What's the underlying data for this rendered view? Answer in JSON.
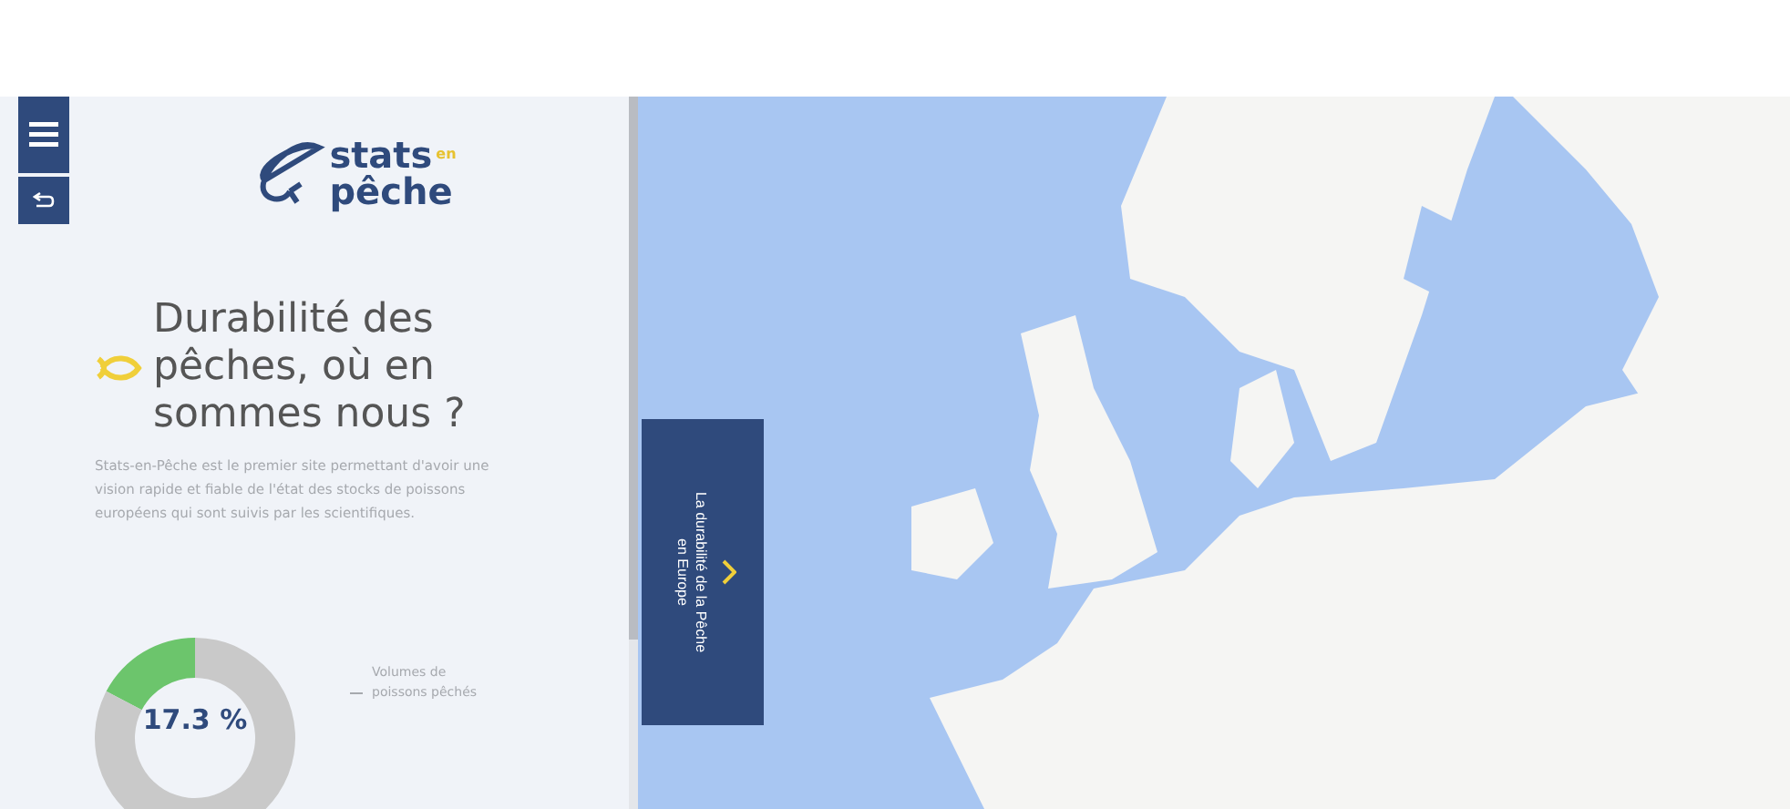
{
  "logo": {
    "line_1": "stats",
    "line_2": "en",
    "line_3": "pêche"
  },
  "title": "Durabilité des pêches, où en sommes nous ?",
  "intro": "Stats-en-Pêche est le premier site permettant d'avoir une vision rapide et fiable de l'état des stocks de poissons européens qui sont suivis par les scientifiques.",
  "summary": {
    "center_label": "17.3 %",
    "legend": "Volumes de poissons pêchés",
    "chart_data": {
      "type": "donut",
      "values": [
        17.3,
        82.7
      ]
    }
  },
  "side_tab": {
    "label": "La durabilité de la Pêche en Europe"
  }
}
